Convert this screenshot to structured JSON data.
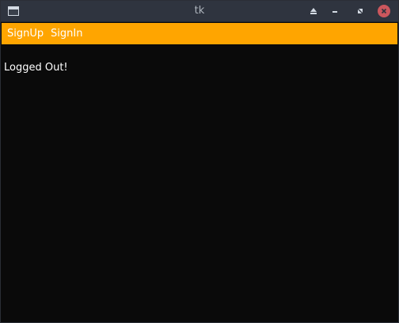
{
  "window": {
    "title": "tk",
    "title_color": "#aeb5bd",
    "titlebar_color": "#2f343f",
    "background_color": "#0a0a0a"
  },
  "titlebar_buttons": {
    "shade": "eject-icon",
    "minimize": "minimize-icon",
    "maximize": "restore-icon",
    "close": "close-icon",
    "close_color": "#cc575d"
  },
  "menubar": {
    "background_color": "#ffa500",
    "items": [
      {
        "label": "SignUp"
      },
      {
        "label": "SignIn"
      }
    ]
  },
  "main": {
    "status_text": "Logged Out!"
  }
}
